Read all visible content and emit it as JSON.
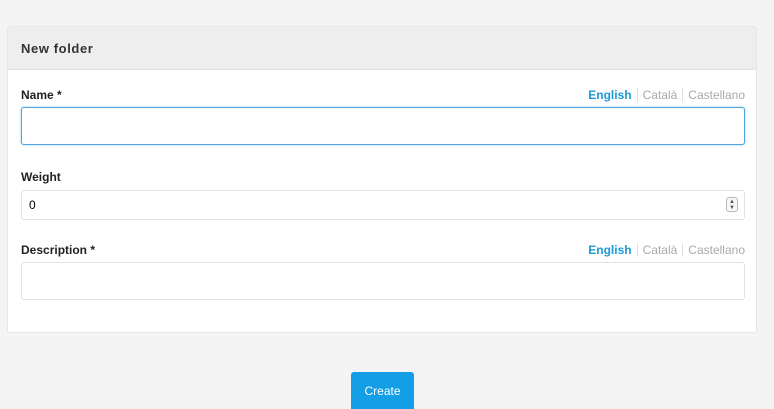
{
  "panel": {
    "title": "New folder"
  },
  "fields": {
    "name": {
      "label": "Name *",
      "value": "",
      "languages": [
        "English",
        "Català",
        "Castellano"
      ],
      "active_language": "English"
    },
    "weight": {
      "label": "Weight",
      "value": "0"
    },
    "description": {
      "label": "Description *",
      "value": "",
      "languages": [
        "English",
        "Català",
        "Castellano"
      ],
      "active_language": "English"
    }
  },
  "actions": {
    "create_label": "Create"
  },
  "colors": {
    "accent": "#139ee6",
    "active_language": "#1a9ad6",
    "inactive_language": "#a9a9a9"
  },
  "icons": {
    "spinner": "spinner-up-down-icon"
  }
}
